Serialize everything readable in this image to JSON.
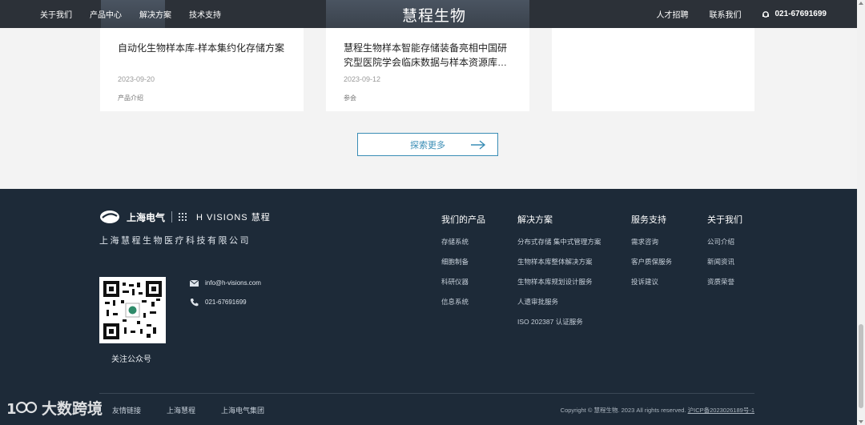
{
  "nav": {
    "left_items": [
      "关于我们",
      "产品中心",
      "解决方案",
      "技术支持"
    ],
    "brand": "慧程生物",
    "right_items": [
      "人才招聘",
      "联系我们"
    ],
    "phone": "021-67691699"
  },
  "cards": [
    {
      "title": "自动化生物样本库-样本集约化存储方案",
      "date": "2023-09-20",
      "tag": "产品介绍"
    },
    {
      "title": "慧程生物样本智能存储装备亮相中国研究型医院学会临床数据与样本资源库…",
      "date": "2023-09-12",
      "tag": "参会"
    }
  ],
  "explore": {
    "label": "探索更多"
  },
  "footer": {
    "logo_left": "上海电气",
    "logo_right": "H VISIONS 慧程",
    "company": "上海慧程生物医疗科技有限公司",
    "qr_label": "关注公众号",
    "email": "info@h-visions.com",
    "phone": "021-67691699",
    "columns": [
      {
        "title": "我们的产品",
        "items": [
          "存储系统",
          "细胞制备",
          "科研仪器",
          "信息系统"
        ]
      },
      {
        "title": "解决方案",
        "items": [
          "分布式存储 集中式管理方案",
          "生物样本库整体解决方案",
          "生物样本库规划设计服务",
          "人遗审批服务",
          "ISO 202387 认证服务"
        ]
      },
      {
        "title": "服务支持",
        "items": [
          "需求咨询",
          "客户质保服务",
          "投诉建议"
        ]
      },
      {
        "title": "关于我们",
        "items": [
          "公司介绍",
          "新闻资讯",
          "资质荣誉"
        ]
      }
    ],
    "links": [
      "友情链接",
      "上海慧程",
      "上海电气集团"
    ],
    "copyright": "Copyright © 慧程生物. 2023 All rights reserved.",
    "icp": "沪ICP备2023026189号-1"
  },
  "watermark": "大数跨境",
  "colors": {
    "nav_bg": "#2c3138",
    "footer_bg": "#1d2a38",
    "accent": "#3a8db5"
  }
}
